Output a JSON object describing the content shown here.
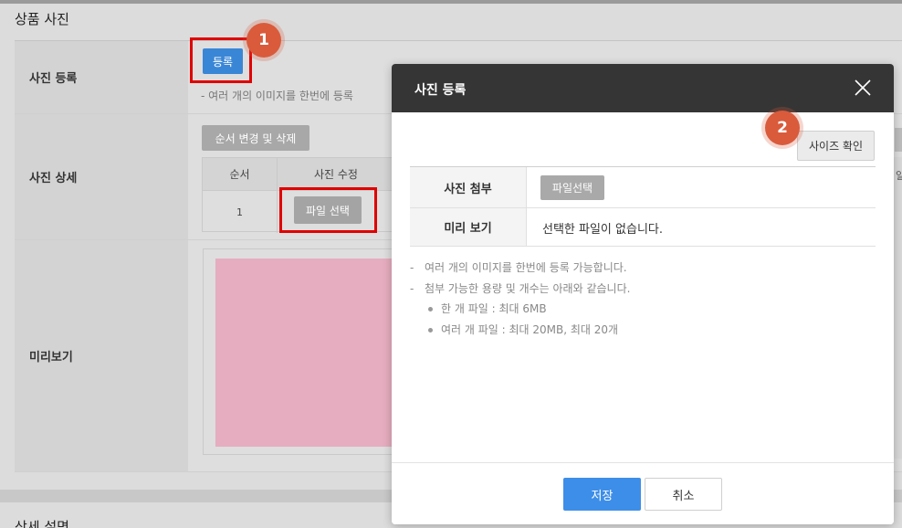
{
  "background": {
    "section_title": "상품 사진",
    "rows": {
      "register_label": "사진 등록",
      "detail_label": "사진 상세",
      "preview_label": "미리보기"
    },
    "register_button": "등록",
    "hint": "-  여러 개의 이미지를 한번에 등록",
    "order_delete_button": "순서 변경 및 삭제",
    "table_headers": [
      "순서",
      "사진 수정"
    ],
    "table_row": {
      "order": "1",
      "file_button": "파일 선택"
    },
    "bottom_title": "상세 설명",
    "right_edge_text": "일"
  },
  "badges": {
    "first": "1",
    "second": "2"
  },
  "modal": {
    "title": "사진 등록",
    "size_check_button": "사이즈 확인",
    "attach_label": "사진 첨부",
    "file_select_button": "파일선택",
    "preview_label": "미리 보기",
    "no_file_text": "선택한 파일이 없습니다.",
    "notes": [
      "여러 개의 이미지를 한번에 등록 가능합니다.",
      "첨부 가능한 용량 및 개수는 아래와 같습니다."
    ],
    "bullets": [
      "한 개 파일 : 최대 6MB",
      "여러 개 파일 : 최대 20MB, 최대 20개"
    ],
    "save_button": "저장",
    "cancel_button": "취소"
  },
  "colors": {
    "accent_blue": "#3d8ee8",
    "header_dark": "#353535",
    "highlight_red": "#e00000",
    "badge_orange": "#d95b3c",
    "preview_pink": "#e5adbf"
  }
}
